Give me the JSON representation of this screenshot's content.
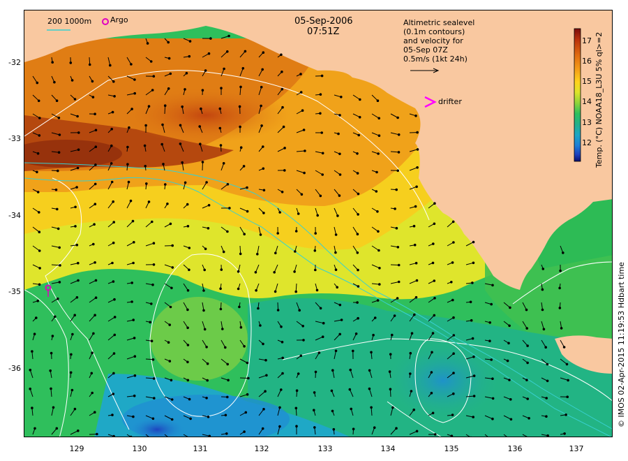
{
  "header": {
    "date": "05-Sep-2006",
    "time": "07:51Z"
  },
  "legend": {
    "contours_label": "200  1000m",
    "argo_label": "Argo",
    "drifter_label": "drifter",
    "sealevel_lines": [
      "Altimetric sealevel",
      "(0.1m contours)",
      "and velocity for",
      "05-Sep 07Z",
      "0.5m/s (1kt 24h)"
    ]
  },
  "colorbar": {
    "title": "Temp. (°C) NOAA18_L3U 5% ql>=2",
    "ticks": [
      "17",
      "16",
      "15",
      "14",
      "13",
      "12"
    ],
    "colors": [
      "#7a0c0c",
      "#b8300c",
      "#e06b10",
      "#f39a18",
      "#ffd21c",
      "#dde42a",
      "#8fd43a",
      "#2fc05c",
      "#23b08a",
      "#1ea6c4",
      "#1f7fd6",
      "#1d3fbe",
      "#0b0f6c"
    ]
  },
  "axes": {
    "x_ticks": [
      "129",
      "130",
      "131",
      "132",
      "133",
      "134",
      "135",
      "136",
      "137"
    ],
    "y_ticks": [
      "-32",
      "-33",
      "-34",
      "-35",
      "-36"
    ]
  },
  "credit": "© IMOS 02-Apr-2015 11:19:53 Hdbart time",
  "colors": {
    "land": "#f9c8a0",
    "contour": "#ffffff",
    "bathymetry": "#38d0d0",
    "argo": "#e000c0",
    "drifter": "#ff00ff"
  }
}
